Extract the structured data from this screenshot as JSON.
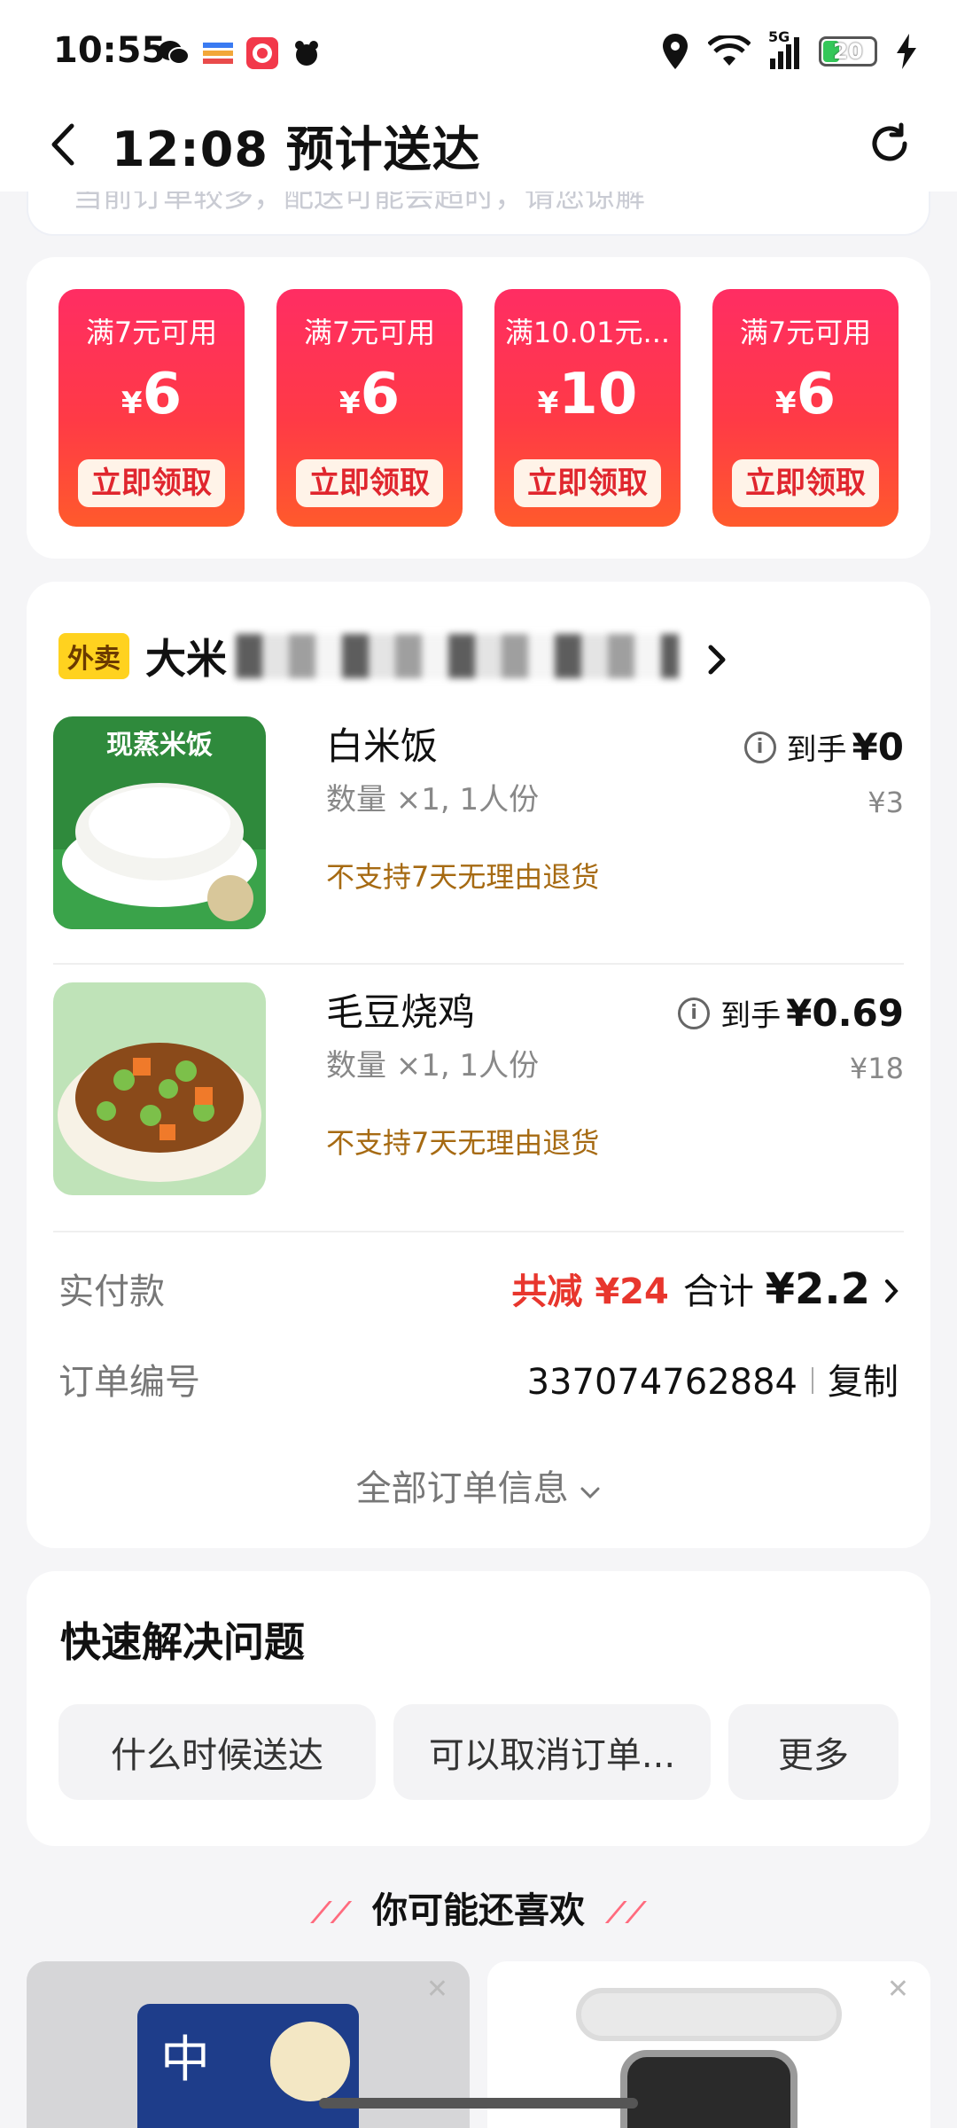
{
  "status_bar": {
    "time": "10:55",
    "network": "5G",
    "battery": "20"
  },
  "header": {
    "title": "12:08 预计送达"
  },
  "notice": {
    "text": "当前订单较多，配送可能会超时，请您谅解"
  },
  "coupons": [
    {
      "condition": "满7元可用",
      "yen": "¥",
      "amount": "6",
      "button": "立即领取"
    },
    {
      "condition": "满7元可用",
      "yen": "¥",
      "amount": "6",
      "button": "立即领取"
    },
    {
      "condition": "满10.01元...",
      "yen": "¥",
      "amount": "10",
      "button": "立即领取"
    },
    {
      "condition": "满7元可用",
      "yen": "¥",
      "amount": "6",
      "button": "立即领取"
    }
  ],
  "store": {
    "tag": "外卖",
    "name": "大米"
  },
  "items": [
    {
      "name": "白米饭",
      "image_text": "现蒸米饭",
      "qty": "数量 ×1, 1人份",
      "policy": "不支持7天无理由退货",
      "price_label": "到手",
      "price": "¥0",
      "original": "¥3"
    },
    {
      "name": "毛豆烧鸡",
      "qty": "数量 ×1, 1人份",
      "policy": "不支持7天无理由退货",
      "price_label": "到手",
      "price": "¥0.69",
      "original": "¥18"
    }
  ],
  "payment": {
    "label": "实付款",
    "discount": "共减 ¥24",
    "total_label": "合计",
    "total": "¥2.2"
  },
  "order_no": {
    "label": "订单编号",
    "value": "337074762884",
    "copy": "复制"
  },
  "all_info": "全部订单信息",
  "help": {
    "title": "快速解决问题",
    "chips": [
      "什么时候送达",
      "可以取消订单...",
      "更多"
    ]
  },
  "recommend": {
    "title": "你可能还喜欢",
    "card_text": "中"
  },
  "colors": {
    "coupon_red": "#ff2d63",
    "discount_red": "#e8362d",
    "policy_brown": "#a66a12",
    "store_tag_yellow": "#ffd21f"
  }
}
